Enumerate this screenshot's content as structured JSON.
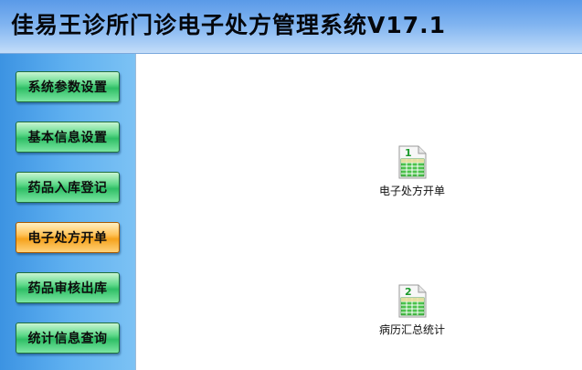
{
  "header": {
    "title": "佳易王诊所门诊电子处方管理系统V17.1"
  },
  "sidebar": {
    "items": [
      {
        "label": "系统参数设置",
        "active": false
      },
      {
        "label": "基本信息设置",
        "active": false
      },
      {
        "label": "药品入库登记",
        "active": false
      },
      {
        "label": "电子处方开单",
        "active": true
      },
      {
        "label": "药品审核出库",
        "active": false
      },
      {
        "label": "统计信息查询",
        "active": false
      }
    ]
  },
  "main": {
    "tiles": [
      {
        "number": "1",
        "label": "电子处方开单",
        "icon": "spreadsheet-icon"
      },
      {
        "number": "2",
        "label": "病历汇总统计",
        "icon": "spreadsheet-icon"
      }
    ]
  },
  "colors": {
    "title_bar": "#7fb3f0",
    "sidebar": "#5fb0f0",
    "button_green": "#2fbf66",
    "button_active_orange": "#f5a21c",
    "icon_number": "#1a9a2a",
    "icon_grid": "#4bc24b"
  }
}
